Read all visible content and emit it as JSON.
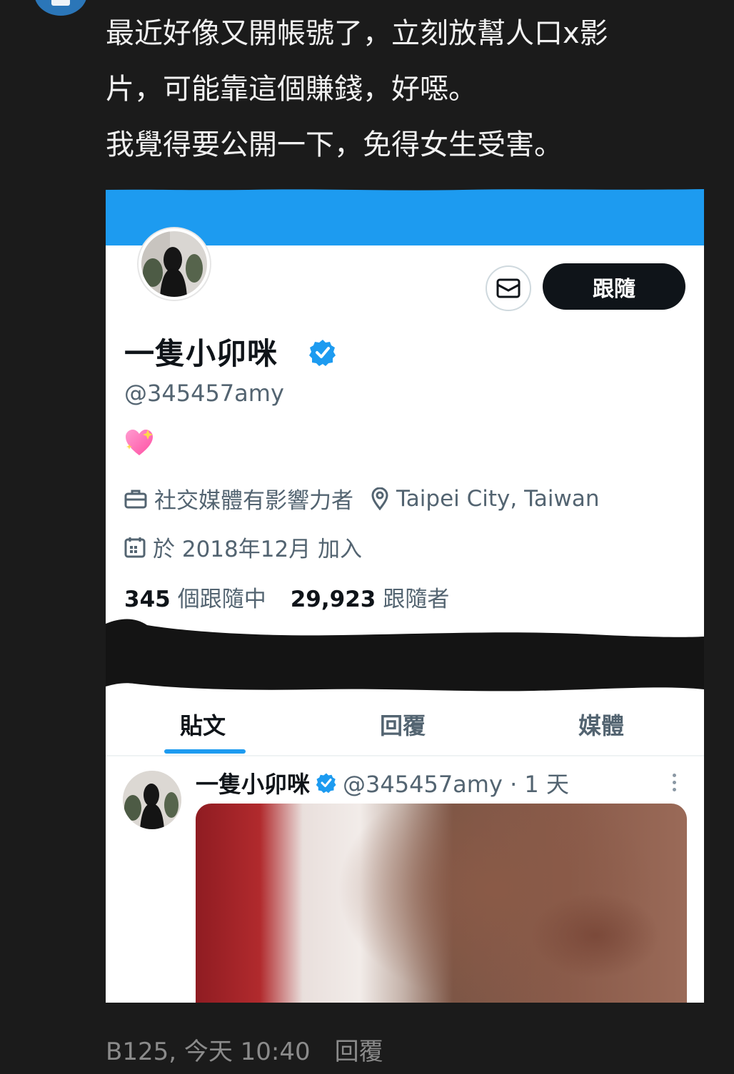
{
  "post": {
    "lines": [
      "最近好像又開帳號了，立刻放幫人口x影",
      "片，可能靠這個賺錢，好噁。",
      "我覺得要公開一下，免得女生受害。"
    ]
  },
  "profile": {
    "follow_label": "跟隨",
    "display_name": "一隻小卯咪",
    "handle": "@345457amy",
    "category": "社交媒體有影響力者",
    "location": "Taipei City, Taiwan",
    "joined": "於 2018年12月 加入",
    "following_count": "345",
    "following_label": "個跟隨中",
    "followers_count": "29,923",
    "followers_label": "跟隨者"
  },
  "tabs": [
    "貼文",
    "回覆",
    "媒體"
  ],
  "tweet": {
    "name": "一隻小卯咪",
    "meta": "@345457amy · 1 天"
  },
  "footer": {
    "info": "B125, 今天 10:40",
    "reply_label": "回覆"
  },
  "colors": {
    "banner": "#1d9bf0",
    "verified": "#1d9bf0",
    "page_bg": "#1b1b1b"
  }
}
